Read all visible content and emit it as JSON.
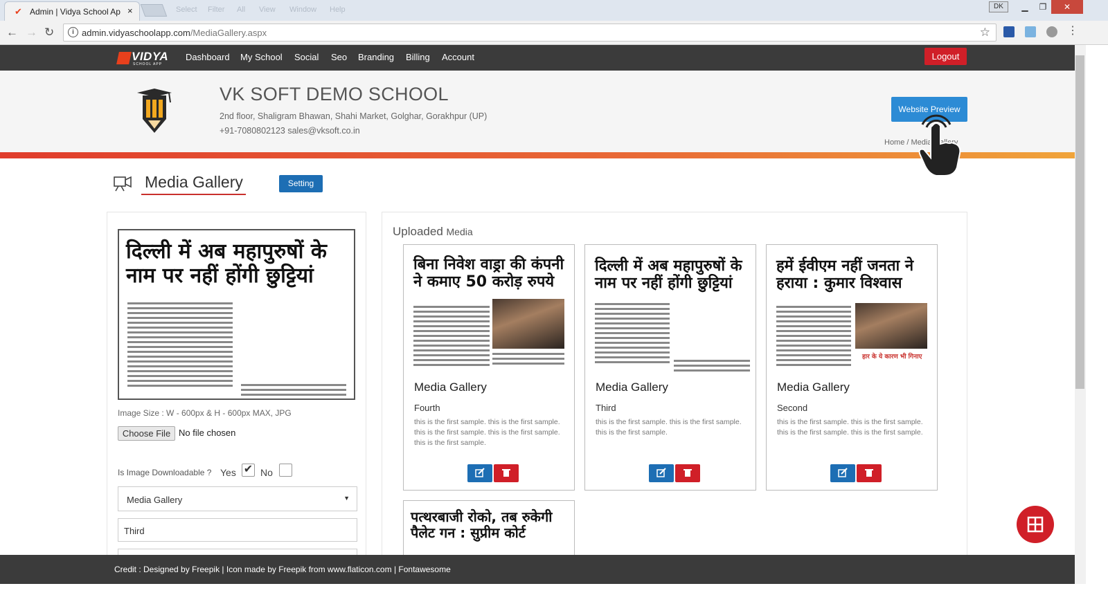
{
  "browser": {
    "tab_title": "Admin | Vidya School Ap",
    "tab_close": "×",
    "ghost_tabs": [
      "Select",
      "Filter",
      "All",
      "View",
      "Window",
      "Help"
    ],
    "url_host": "admin.vidyaschoolapp.com",
    "url_path": "/MediaGallery.aspx",
    "profile": "DK"
  },
  "nav": {
    "logo_text": "VIDYA",
    "logo_sub": "SCHOOL APP",
    "items": [
      "Dashboard",
      "My School",
      "Social",
      "Seo",
      "Branding",
      "Billing",
      "Account"
    ],
    "logout": "Logout"
  },
  "school": {
    "name": "VK SOFT DEMO SCHOOL",
    "address": "2nd floor, Shaligram Bhawan, Shahi Market, Golghar, Gorakhpur (UP)",
    "contact": "+91-7080802123  sales@vksoft.co.in",
    "website_preview": "Website Preview",
    "breadcrumb": "Home / Media Gallery"
  },
  "section": {
    "title": "Media Gallery",
    "setting_button": "Setting"
  },
  "form": {
    "preview_headline": "दिल्ली में अब महापुरुषों के नाम पर नहीं होंगी छुट्टियां",
    "image_size_hint": "Image Size : W - 600px & H - 600px MAX, JPG",
    "choose_file": "Choose File",
    "no_file": "No file chosen",
    "downloadable_label": "Is Image Downloadable ?",
    "yes_label": "Yes",
    "no_label": "No",
    "yes_checked": true,
    "no_checked": false,
    "category_selected": "Media Gallery",
    "subtitle_value": "Third"
  },
  "uploaded": {
    "heading": "Uploaded",
    "heading_small": "Media",
    "cards": [
      {
        "headline": "बिना निवेश वाड्रा की कंपनी ने कमाए 50 करोड़ रुपये",
        "title": "Media Gallery",
        "subtitle": "Fourth",
        "description": "this is the first sample. this is the first sample. this is the first sample. this is the first sample. this is the first sample."
      },
      {
        "headline": "दिल्ली में अब महापुरुषों के नाम पर नहीं होंगी छुट्टियां",
        "title": "Media Gallery",
        "subtitle": "Third",
        "description": "this is the first sample. this is the first sample. this is the first sample."
      },
      {
        "headline": "हमें ईवीएम नहीं जनता ने हराया : कुमार विश्वास",
        "caption": "हार के ये कारण भी गिनाए",
        "title": "Media Gallery",
        "subtitle": "Second",
        "description": "this is the first sample. this is the first sample. this is the first sample. this is the first sample."
      },
      {
        "headline": "पत्थरबाजी रोको, तब रुकेगी पैलेट गन : सुप्रीम कोर्ट"
      }
    ]
  },
  "footer": {
    "credit": "Credit : Designed by Freepik | Icon made by Freepik from www.flaticon.com | Fontawesome"
  },
  "colors": {
    "nav_bg": "#3b3b3b",
    "accent_red": "#d01f28",
    "accent_blue": "#1d6eb4",
    "stripe_orange": "#e86a36"
  }
}
